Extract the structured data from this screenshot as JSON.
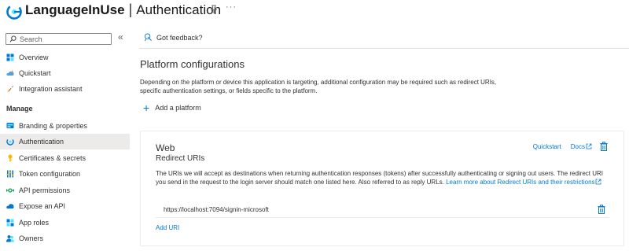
{
  "header": {
    "app_name": "LanguageInUse",
    "separator": "|",
    "page_name": "Authentication",
    "more": "···"
  },
  "sidebar": {
    "search_placeholder": "Search",
    "collapse": "«",
    "items_top": [
      {
        "label": "Overview",
        "icon": "grid-icon"
      },
      {
        "label": "Quickstart",
        "icon": "rocket-cloud-icon"
      },
      {
        "label": "Integration assistant",
        "icon": "rocket-icon"
      }
    ],
    "section_manage": "Manage",
    "items_manage": [
      {
        "label": "Branding & properties",
        "icon": "branding-icon"
      },
      {
        "label": "Authentication",
        "icon": "auth-icon",
        "active": true
      },
      {
        "label": "Certificates & secrets",
        "icon": "key-icon"
      },
      {
        "label": "Token configuration",
        "icon": "token-icon"
      },
      {
        "label": "API permissions",
        "icon": "api-permissions-icon"
      },
      {
        "label": "Expose an API",
        "icon": "cloud-icon"
      },
      {
        "label": "App roles",
        "icon": "app-roles-icon"
      },
      {
        "label": "Owners",
        "icon": "owners-icon"
      }
    ]
  },
  "main": {
    "feedback": "Got feedback?",
    "title": "Platform configurations",
    "description": "Depending on the platform or device this application is targeting, additional configuration may be required such as redirect URIs, specific authentication settings, or fields specific to the platform.",
    "add_platform": "Add a platform",
    "card": {
      "title": "Web",
      "subtitle": "Redirect URIs",
      "quickstart": "Quickstart",
      "docs": "Docs",
      "description": "The URIs we will accept as destinations when returning authentication responses (tokens) after successfully authenticating or signing out users. The redirect URI you send in the request to the login server should match one listed here. Also referred to as reply URLs.",
      "learn_more": "Learn more about Redirect URIs and their restrictions",
      "uri": "https://localhost:7094/signin-microsoft",
      "add_uri": "Add URI"
    }
  },
  "colors": {
    "accent": "#0078d4",
    "text": "#323130",
    "active_bg": "#edebe9"
  }
}
